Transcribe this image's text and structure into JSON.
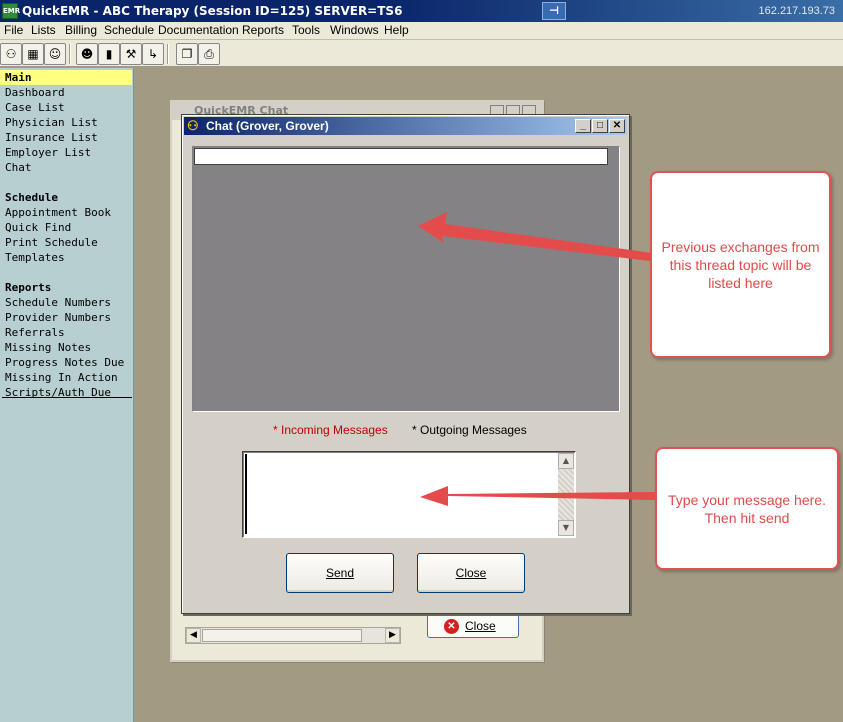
{
  "titlebar": {
    "app_icon_text": "EMR",
    "title": "QuickEMR - ABC Therapy (Session ID=125) SERVER=TS6",
    "ip": "162.217.193.73"
  },
  "menu": {
    "items": [
      "File",
      "Lists",
      "Billing",
      "Schedule",
      "Documentation",
      "Reports",
      "Tools",
      "Windows",
      "Help"
    ]
  },
  "sidebar": {
    "main_header": "Main",
    "main_items": [
      "Dashboard",
      "Case List",
      "Physician List",
      "Insurance List",
      "Employer List",
      "Chat"
    ],
    "schedule_header": "Schedule",
    "schedule_items": [
      "Appointment Book",
      "Quick Find",
      "Print Schedule",
      "Templates"
    ],
    "reports_header": "Reports",
    "reports_items": [
      "Schedule Numbers",
      "Provider Numbers",
      "Referrals",
      "Missing Notes",
      "Progress Notes Due",
      "Missing In Action",
      "Scripts/Auth Due"
    ]
  },
  "bg_window": {
    "title": "QuickEMR Chat",
    "close_label": "Close"
  },
  "chat": {
    "title": "Chat (Grover, Grover)",
    "topic_value": "",
    "legend_incoming": "* Incoming Messages",
    "legend_outgoing": "* Outgoing Messages",
    "message_value": "",
    "send_label": "Send",
    "close_label": "Close"
  },
  "callouts": {
    "history": "Previous exchanges from this thread topic will be listed here",
    "message": "Type your message here. Then hit send"
  },
  "colors": {
    "callout_red": "#e04a4a",
    "incoming_red": "#c00000",
    "sidebar_bg": "#b8cfd2",
    "desktop_bg": "#a39a84"
  }
}
